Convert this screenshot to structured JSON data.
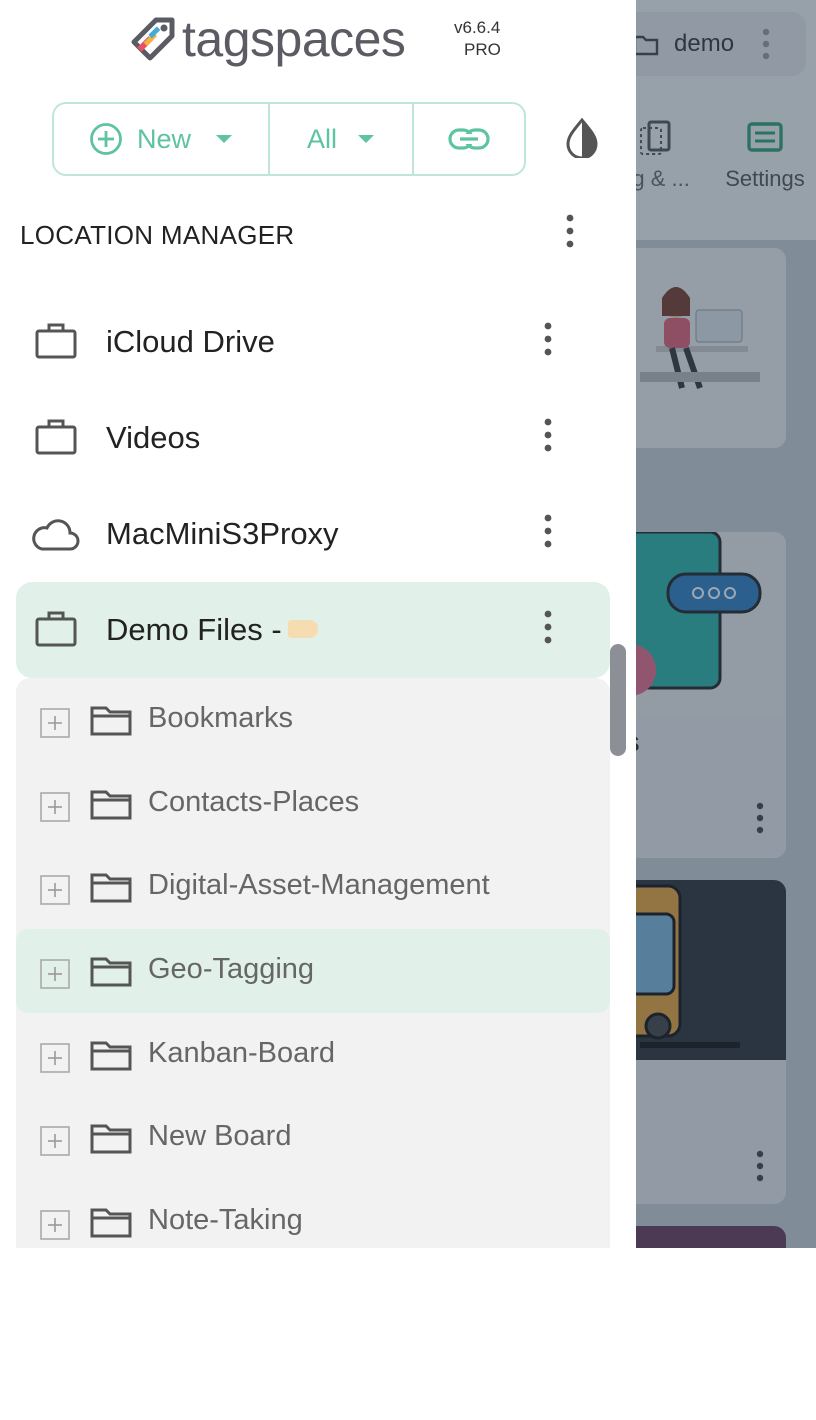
{
  "app": {
    "logo_text": "tagspaces",
    "version": "v6.6.4",
    "edition": "PRO"
  },
  "toolbar": {
    "new_label": "New",
    "filter_label": "All"
  },
  "location_manager": {
    "title": "LOCATION MANAGER",
    "locations": [
      {
        "name": "iCloud Drive",
        "icon": "briefcase-icon"
      },
      {
        "name": "Videos",
        "icon": "briefcase-icon"
      },
      {
        "name": "MacMiniS3Proxy",
        "icon": "cloud-icon"
      },
      {
        "name": "Demo Files -",
        "icon": "briefcase-icon",
        "active": true
      }
    ],
    "folders": [
      {
        "name": "Bookmarks"
      },
      {
        "name": "Contacts-Places"
      },
      {
        "name": "Digital-Asset-Management"
      },
      {
        "name": "Geo-Tagging",
        "highlighted": true
      },
      {
        "name": "Kanban-Board"
      },
      {
        "name": "New Board"
      },
      {
        "name": "Note-Taking"
      }
    ]
  },
  "background": {
    "breadcrumb": "demo",
    "toolbar_items": [
      "ng & ...",
      "Settings"
    ],
    "card_title_fragment": "es"
  },
  "colors": {
    "accent": "#5ec3a0",
    "accent_border": "#bfe6d6",
    "active_bg": "#e1f1ea",
    "tree_bg": "#f2f2f2",
    "tag_color": "#f6ddb1"
  }
}
